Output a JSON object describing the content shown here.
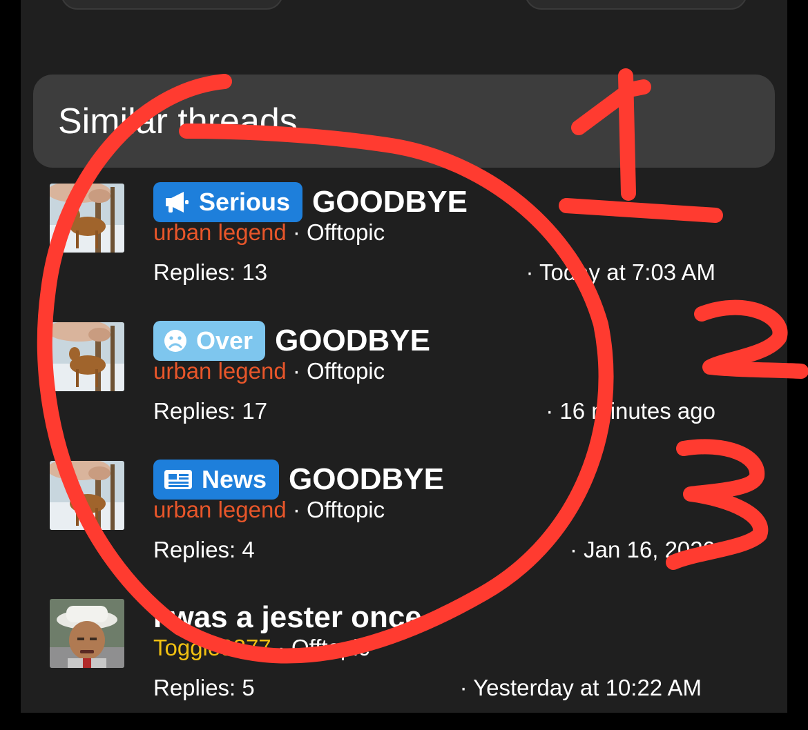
{
  "section": {
    "title": "Similar threads"
  },
  "threads": [
    {
      "prefix": "Serious",
      "prefix_icon": "megaphone-icon",
      "prefix_color": "#1e7fdb",
      "title": "GOODBYE",
      "author": "urban legend",
      "separator": "·",
      "forum": "Offtopic",
      "replies": "Replies: 13",
      "date": "· Today at 7:03 AM"
    },
    {
      "prefix": "Over",
      "prefix_icon": "sad-face-icon",
      "prefix_color": "#7ec6ee",
      "title": "GOODBYE",
      "author": "urban legend",
      "separator": "·",
      "forum": "Offtopic",
      "replies": "Replies: 17",
      "date": "· 16 minutes ago"
    },
    {
      "prefix": "News",
      "prefix_icon": "newspaper-icon",
      "prefix_color": "#1e7fdb",
      "title": "GOODBYE",
      "author": "urban legend",
      "separator": "·",
      "forum": "Offtopic",
      "replies": "Replies: 4",
      "date": "· Jan 16, 2020"
    },
    {
      "prefix": "",
      "title": "I was a jester once",
      "author": "Toggle9877",
      "separator": "·",
      "forum": "Offtopic",
      "replies": "Replies: 5",
      "date": "· Yesterday at 10:22 AM"
    }
  ],
  "annotations": {
    "marks": [
      "1",
      "2",
      "3"
    ],
    "color": "#ff3b30"
  }
}
